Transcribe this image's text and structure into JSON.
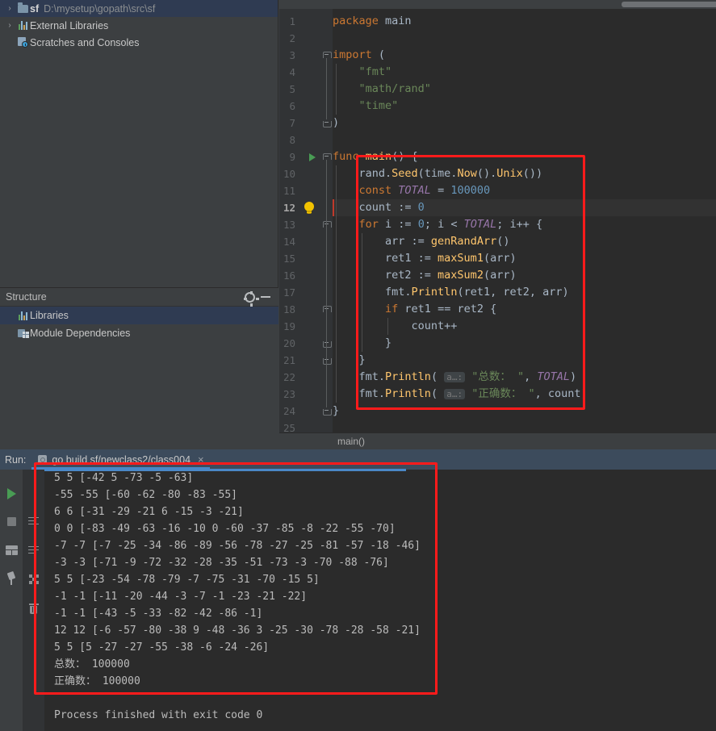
{
  "project": {
    "items": [
      {
        "arrow": "›",
        "icon": "folder-icon",
        "name": "sf",
        "path": "D:\\mysetup\\gopath\\src\\sf",
        "selected": true
      },
      {
        "arrow": "›",
        "icon": "library-icon",
        "name": "External Libraries",
        "path": "",
        "selected": false
      },
      {
        "arrow": "",
        "icon": "scratches-icon",
        "name": "Scratches and Consoles",
        "path": "",
        "selected": false
      }
    ]
  },
  "structure": {
    "title": "Structure",
    "gear_tooltip": "Settings",
    "minimize_tooltip": "Hide",
    "items": [
      {
        "icon": "libraries-icon",
        "label": "Libraries",
        "selected": true
      },
      {
        "icon": "module-dependencies-icon",
        "label": "Module Dependencies",
        "selected": false
      }
    ]
  },
  "editor": {
    "breadcrumb": "main()",
    "current_line": 12,
    "lines": [
      {
        "n": 1,
        "tokens": [
          {
            "t": "kw",
            "v": "package"
          },
          {
            "t": "pln",
            "v": " main"
          }
        ]
      },
      {
        "n": 2,
        "tokens": []
      },
      {
        "n": 3,
        "tokens": [
          {
            "t": "kw",
            "v": "import"
          },
          {
            "t": "pln",
            "v": " ("
          }
        ]
      },
      {
        "n": 4,
        "tokens": [
          {
            "t": "pln",
            "v": "    "
          },
          {
            "t": "str",
            "v": "\"fmt\""
          }
        ]
      },
      {
        "n": 5,
        "tokens": [
          {
            "t": "pln",
            "v": "    "
          },
          {
            "t": "str",
            "v": "\"math/rand\""
          }
        ]
      },
      {
        "n": 6,
        "tokens": [
          {
            "t": "pln",
            "v": "    "
          },
          {
            "t": "str",
            "v": "\"time\""
          }
        ]
      },
      {
        "n": 7,
        "tokens": [
          {
            "t": "pln",
            "v": ")"
          }
        ]
      },
      {
        "n": 8,
        "tokens": []
      },
      {
        "n": 9,
        "tokens": [
          {
            "t": "kw",
            "v": "func"
          },
          {
            "t": "pln",
            "v": " "
          },
          {
            "t": "fn",
            "v": "main"
          },
          {
            "t": "pln",
            "v": "() {"
          }
        ]
      },
      {
        "n": 10,
        "tokens": [
          {
            "t": "pln",
            "v": "    rand."
          },
          {
            "t": "fn",
            "v": "Seed"
          },
          {
            "t": "pln",
            "v": "(time."
          },
          {
            "t": "fn",
            "v": "Now"
          },
          {
            "t": "pln",
            "v": "()."
          },
          {
            "t": "fn",
            "v": "Unix"
          },
          {
            "t": "pln",
            "v": "())"
          }
        ]
      },
      {
        "n": 11,
        "tokens": [
          {
            "t": "pln",
            "v": "    "
          },
          {
            "t": "kw",
            "v": "const"
          },
          {
            "t": "pln",
            "v": " "
          },
          {
            "t": "cnst",
            "v": "TOTAL"
          },
          {
            "t": "pln",
            "v": " = "
          },
          {
            "t": "num",
            "v": "100000"
          }
        ]
      },
      {
        "n": 12,
        "tokens": [
          {
            "t": "pln",
            "v": "    count := "
          },
          {
            "t": "num",
            "v": "0"
          }
        ]
      },
      {
        "n": 13,
        "tokens": [
          {
            "t": "pln",
            "v": "    "
          },
          {
            "t": "kw",
            "v": "for"
          },
          {
            "t": "pln",
            "v": " i := "
          },
          {
            "t": "num",
            "v": "0"
          },
          {
            "t": "pln",
            "v": "; i < "
          },
          {
            "t": "cnst",
            "v": "TOTAL"
          },
          {
            "t": "pln",
            "v": "; i++ {"
          }
        ]
      },
      {
        "n": 14,
        "tokens": [
          {
            "t": "pln",
            "v": "        arr := "
          },
          {
            "t": "fn",
            "v": "genRandArr"
          },
          {
            "t": "pln",
            "v": "()"
          }
        ]
      },
      {
        "n": 15,
        "tokens": [
          {
            "t": "pln",
            "v": "        ret1 := "
          },
          {
            "t": "fn",
            "v": "maxSum1"
          },
          {
            "t": "pln",
            "v": "(arr)"
          }
        ]
      },
      {
        "n": 16,
        "tokens": [
          {
            "t": "pln",
            "v": "        ret2 := "
          },
          {
            "t": "fn",
            "v": "maxSum2"
          },
          {
            "t": "pln",
            "v": "(arr)"
          }
        ]
      },
      {
        "n": 17,
        "tokens": [
          {
            "t": "pln",
            "v": "        fmt."
          },
          {
            "t": "fn",
            "v": "Println"
          },
          {
            "t": "pln",
            "v": "(ret1, ret2, arr)"
          }
        ]
      },
      {
        "n": 18,
        "tokens": [
          {
            "t": "pln",
            "v": "        "
          },
          {
            "t": "kw",
            "v": "if"
          },
          {
            "t": "pln",
            "v": " ret1 == ret2 {"
          }
        ]
      },
      {
        "n": 19,
        "tokens": [
          {
            "t": "pln",
            "v": "            count++"
          }
        ]
      },
      {
        "n": 20,
        "tokens": [
          {
            "t": "pln",
            "v": "        }"
          }
        ]
      },
      {
        "n": 21,
        "tokens": [
          {
            "t": "pln",
            "v": "    }"
          }
        ]
      },
      {
        "n": 22,
        "tokens": [
          {
            "t": "pln",
            "v": "    fmt."
          },
          {
            "t": "fn",
            "v": "Println"
          },
          {
            "t": "pln",
            "v": "( "
          },
          {
            "t": "hint",
            "v": "a…:"
          },
          {
            "t": "pln",
            "v": " "
          },
          {
            "t": "str",
            "v": "\"总数： \""
          },
          {
            "t": "pln",
            "v": ", "
          },
          {
            "t": "cnst",
            "v": "TOTAL"
          },
          {
            "t": "pln",
            "v": ")"
          }
        ]
      },
      {
        "n": 23,
        "tokens": [
          {
            "t": "pln",
            "v": "    fmt."
          },
          {
            "t": "fn",
            "v": "Println"
          },
          {
            "t": "pln",
            "v": "( "
          },
          {
            "t": "hint",
            "v": "a…:"
          },
          {
            "t": "pln",
            "v": " "
          },
          {
            "t": "str",
            "v": "\"正确数： \""
          },
          {
            "t": "pln",
            "v": ", count)"
          }
        ]
      },
      {
        "n": 24,
        "tokens": [
          {
            "t": "pln",
            "v": "}"
          }
        ]
      },
      {
        "n": 25,
        "tokens": []
      }
    ]
  },
  "run_panel": {
    "label": "Run:",
    "tab_title": "go build sf/newclass2/class004",
    "tab_close": "×",
    "toolbar": [
      {
        "name": "rerun-button",
        "icon": "play-icon"
      },
      {
        "name": "stop-button",
        "icon": "stop-icon"
      },
      {
        "name": "layout-button",
        "icon": "layout-icon"
      },
      {
        "name": "pin-tab-button",
        "icon": "pin-icon"
      }
    ],
    "console_toolbar": [
      {
        "name": "soft-wrap-button",
        "icon": "soft-wrap-icon"
      },
      {
        "name": "scroll-to-end-button",
        "icon": "scroll-end-icon"
      },
      {
        "name": "print-button",
        "icon": "print-icon"
      },
      {
        "name": "clear-all-button",
        "icon": "trash-icon"
      }
    ],
    "console_lines": [
      "5 5 [-42 5 -73 -5 -63]",
      "-55 -55 [-60 -62 -80 -83 -55]",
      "6 6 [-31 -29 -21 6 -15 -3 -21]",
      "0 0 [-83 -49 -63 -16 -10 0 -60 -37 -85 -8 -22 -55 -70]",
      "-7 -7 [-7 -25 -34 -86 -89 -56 -78 -27 -25 -81 -57 -18 -46]",
      "-3 -3 [-71 -9 -72 -32 -28 -35 -51 -73 -3 -70 -88 -76]",
      "5 5 [-23 -54 -78 -79 -7 -75 -31 -70 -15 5]",
      "-1 -1 [-11 -20 -44 -3 -7 -1 -23 -21 -22]",
      "-1 -1 [-43 -5 -33 -82 -42 -86 -1]",
      "12 12 [-6 -57 -80 -38 9 -48 -36 3 -25 -30 -78 -28 -58 -21]",
      "5 5 [5 -27 -27 -55 -38 -6 -24 -26]",
      "总数： 100000",
      "正确数： 100000",
      "",
      "Process finished with exit code 0"
    ]
  },
  "annotations": {
    "code_highlight_color": "#ff1b1b",
    "console_highlight_color": "#ff1b1b"
  }
}
